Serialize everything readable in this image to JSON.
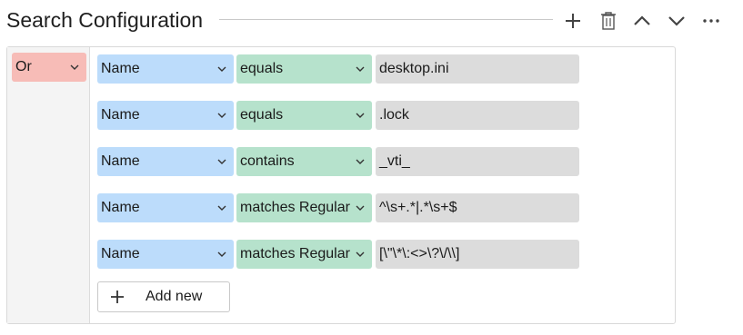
{
  "header": {
    "title": "Search Configuration",
    "icons": [
      "plus-icon",
      "trash-icon",
      "chevron-up-icon",
      "chevron-down-icon",
      "more-icon"
    ]
  },
  "operator": {
    "value": "Or",
    "color": "#f7bcb7"
  },
  "rules": [
    {
      "field": "Name",
      "condition": "equals",
      "value": "desktop.ini"
    },
    {
      "field": "Name",
      "condition": "equals",
      "value": ".lock"
    },
    {
      "field": "Name",
      "condition": "contains",
      "value": "_vti_"
    },
    {
      "field": "Name",
      "condition": "matches Regular Expression",
      "value": "^\\s+.*|.*\\s+$"
    },
    {
      "field": "Name",
      "condition": "matches Regular Expression",
      "value": "[\\\"\\*\\:<>\\?\\/\\\\]"
    }
  ],
  "add_button": {
    "label": "Add new"
  },
  "colors": {
    "field": "#bcdcfb",
    "condition": "#b6e2cc",
    "value": "#dcdcdc"
  }
}
